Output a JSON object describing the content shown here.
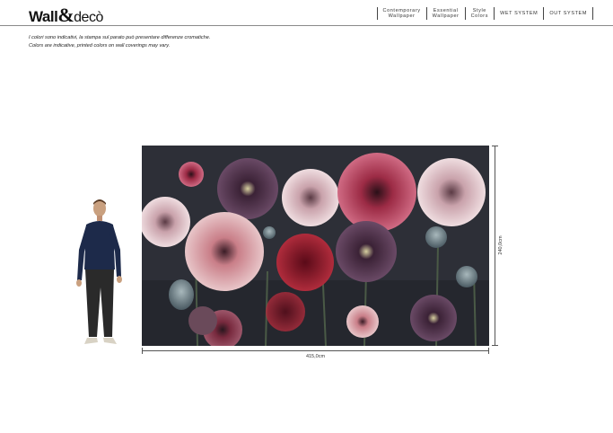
{
  "brand": {
    "name_part1": "Wall",
    "amp": "&",
    "name_part2": "decò"
  },
  "nav": [
    {
      "line1": "Contemporary",
      "line2": "Wallpaper"
    },
    {
      "line1": "Essential",
      "line2": "Wallpaper"
    },
    {
      "line1": "Style",
      "line2": "Colors"
    },
    {
      "line1": "WET SYSTEM",
      "line2": ""
    },
    {
      "line1": "OUT SYSTEM",
      "line2": ""
    }
  ],
  "notes": {
    "italian": "I colori sono indicativi, la stampa sul parato può presentare differenze cromatiche.",
    "english": "Colors are indicative, printed colors on wall coverings may vary."
  },
  "dimensions": {
    "width": "415,0cm",
    "height": "240,0cm"
  },
  "colors": {
    "mural_bg": "#2b2d35",
    "rule": "#8a8a8a"
  }
}
